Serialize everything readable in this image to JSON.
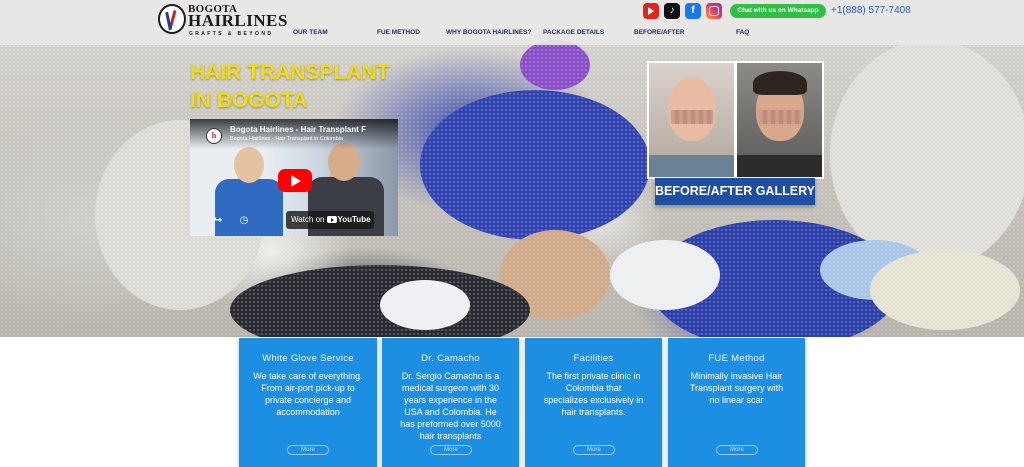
{
  "colors": {
    "nav_text": "#1f2b5e",
    "hero_title": "#f3dd12",
    "whatsapp_green": "#2fbf44",
    "phone_blue": "#2b58c4",
    "card_blue": "#1d8fe3",
    "gallery_button": "#1f4fa3"
  },
  "logo": {
    "line1": "BOGOTA",
    "line2": "HAIRLINES",
    "line3": "GRAFTS & BEYOND"
  },
  "nav": [
    {
      "label": "OUR TEAM"
    },
    {
      "label": "FUE METHOD"
    },
    {
      "label": "WHY BOGOTA HAIRLINES?"
    },
    {
      "label": "PACKAGE DETAILS"
    },
    {
      "label": "BEFORE/AFTER"
    },
    {
      "label": "FAQ"
    }
  ],
  "social": [
    {
      "name": "youtube-icon",
      "glyph": ""
    },
    {
      "name": "tiktok-icon",
      "glyph": "♪"
    },
    {
      "name": "facebook-icon",
      "glyph": "f"
    },
    {
      "name": "instagram-icon",
      "glyph": ""
    }
  ],
  "whatsapp": {
    "label": "Chat with us on Whatsapp"
  },
  "phone": "+1(888) 577-7408",
  "hero": {
    "title_line1": "HAIR TRANSPLANT",
    "title_line2": "IN BOGOTA"
  },
  "video": {
    "title": "Bogota Hairlines - Hair Transplant F",
    "subtitle": "Bogota Hairlines - Hair Transplant in Colombia",
    "watch_on": "Watch on",
    "youtube": "YouTube",
    "share_icon": "share-icon",
    "clock_icon": "clock-icon"
  },
  "gallery": {
    "button_label": "BEFORE/AFTER GALLERY"
  },
  "cards": [
    {
      "title": "White Glove Service",
      "text": "We take care of everything. From air-port pick-up to private concierge and accommodation",
      "more": "More"
    },
    {
      "title": "Dr. Camacho",
      "text": "Dr. Sergio Camacho is a medical surgeon with 30 years experience in the USA and Colombia. He has preformed over 5000 hair transplants",
      "more": "More"
    },
    {
      "title": "Facilities",
      "text": "The first private clinic in Colombia that specializes exclusively in hair transplants.",
      "more": "More"
    },
    {
      "title": "FUE Method",
      "text": "Minimally invasive Hair Transplant surgery with no linear scar",
      "more": "More"
    }
  ]
}
